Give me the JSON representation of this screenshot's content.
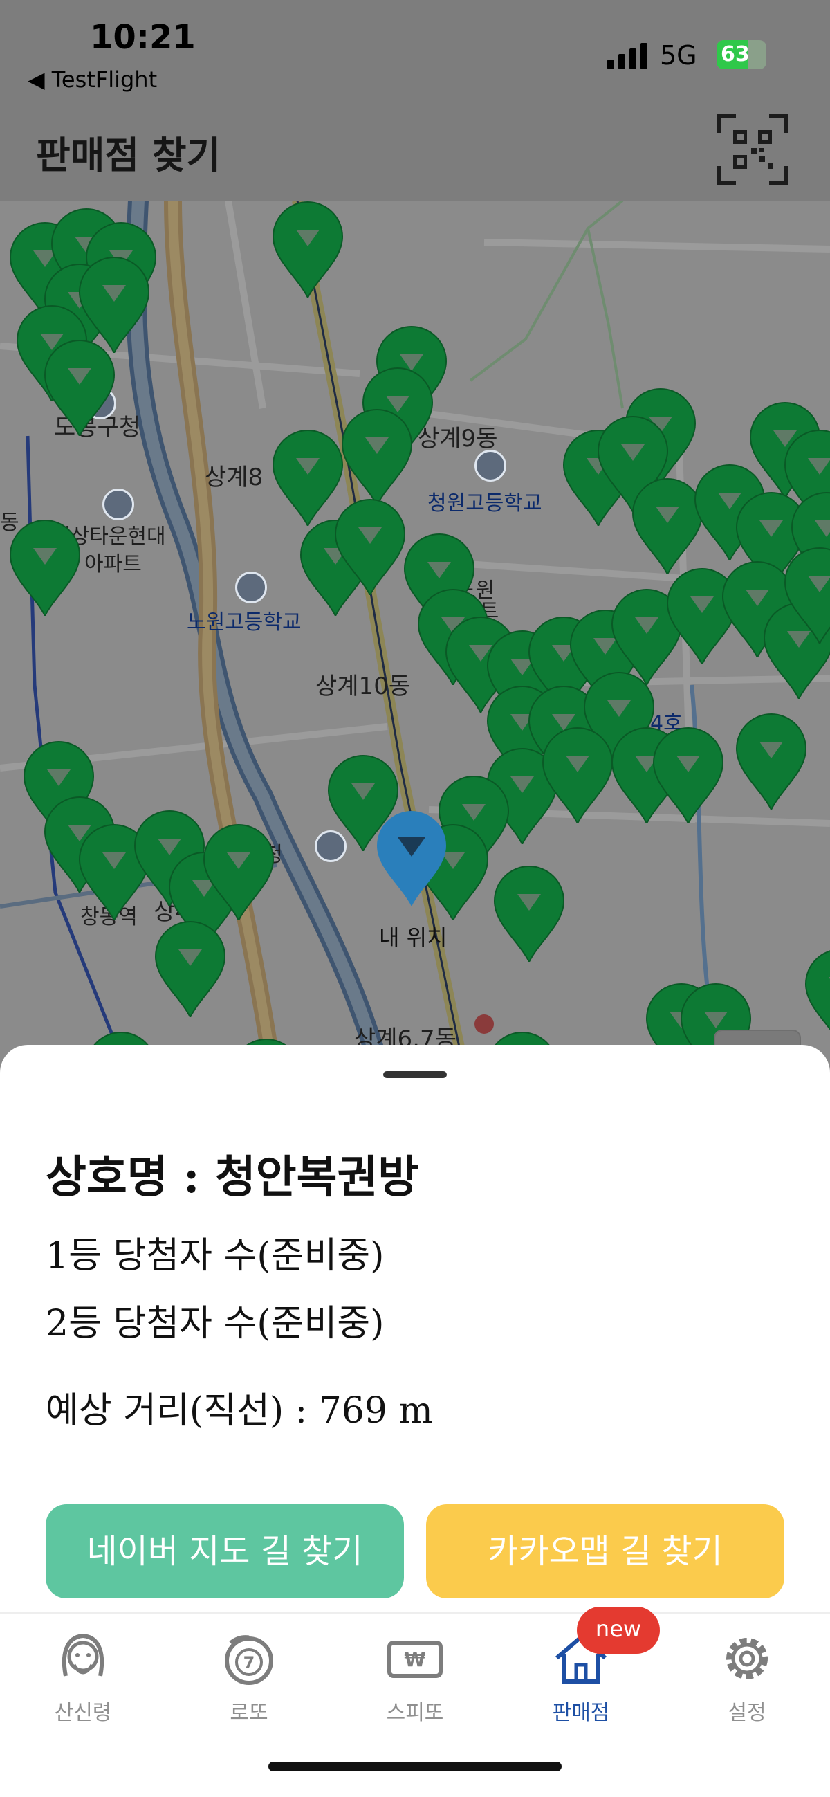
{
  "status_bar": {
    "time": "10:21",
    "back_label": "◀ TestFlight",
    "network": "5G",
    "battery_percent": 63,
    "battery_label": "63"
  },
  "header": {
    "title": "판매점 찾기",
    "qr_icon": "qr-code-icon"
  },
  "map": {
    "labels": [
      "도봉구청",
      "상계9동",
      "상계8",
      "청원고등학교",
      "대상타운현대",
      "아파트",
      "노원",
      "파트",
      "노원고등학교",
      "상계10동",
      "4호",
      "원구청",
      "창동역",
      "상4동",
      "상계6.7동",
      "내 위치",
      "동"
    ],
    "my_location_label": "내 위치",
    "marker_color": "#0d7a34",
    "my_location_color": "#2f8fd3",
    "zoom_in_label": "+",
    "zoom_out_label": "−"
  },
  "store": {
    "name_line": "상호명 : 청안복권방",
    "first_prize_line": "1등 당첨자 수(준비중)",
    "second_prize_line": "2등 당첨자 수(준비중)",
    "distance_line": "예상 거리(직선) : 769 m"
  },
  "buttons": {
    "naver": "네이버 지도 길 찾기",
    "kakao": "카카오맵 길 찾기",
    "naver_color": "#5ec6a0",
    "kakao_color": "#fbcb4c"
  },
  "tabs": [
    {
      "label": "산신령",
      "icon": "mountain-spirit-icon"
    },
    {
      "label": "로또",
      "icon": "lotto-ball-icon"
    },
    {
      "label": "스피또",
      "icon": "scratch-ticket-icon"
    },
    {
      "label": "판매점",
      "icon": "home-icon",
      "active": true
    },
    {
      "label": "설정",
      "icon": "gear-icon"
    }
  ],
  "new_badge": "new"
}
